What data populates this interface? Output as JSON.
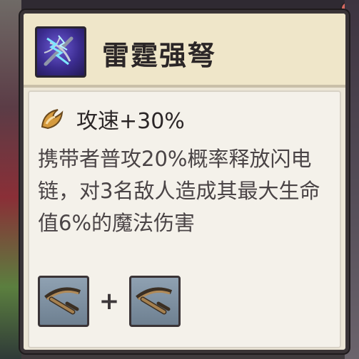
{
  "item": {
    "name": "雷霆强弩",
    "icon": "thunder-crossbow-icon"
  },
  "stat": {
    "icon": "attack-speed-icon",
    "text": "攻速+30%"
  },
  "description": "携带者普攻20%概率释放闪电链，对3名敌人造成其最大生命值6%的魔法伤害",
  "recipe": {
    "ingredients": [
      {
        "icon": "crossbow-icon"
      },
      {
        "icon": "crossbow-icon"
      }
    ],
    "operator": "+"
  },
  "colors": {
    "card_background": "#ece6d6",
    "border": "#3a3437",
    "title_text": "#2b2627",
    "description_text": "#4a4446",
    "stat_icon": "#d59a3d"
  }
}
